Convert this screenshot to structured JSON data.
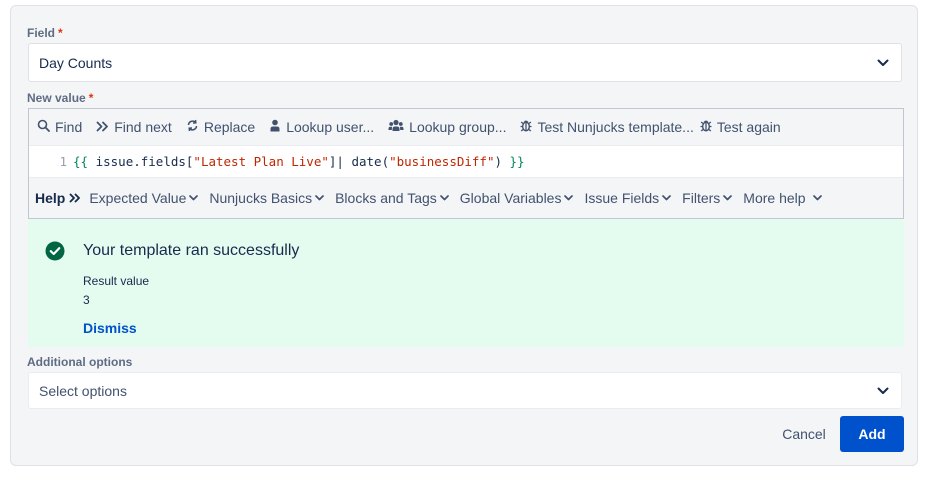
{
  "field": {
    "label": "Field",
    "required_mark": "*",
    "value": "Day Counts"
  },
  "new_value": {
    "label": "New value",
    "required_mark": "*"
  },
  "toolbar": {
    "find": "Find",
    "find_next": "Find next",
    "replace": "Replace",
    "lookup_user": "Lookup user...",
    "lookup_group": "Lookup group...",
    "test_template": "Test Nunjucks template...",
    "test_again": "Test again"
  },
  "editor": {
    "line_number": "1",
    "code": {
      "open": "{{",
      "part1": " issue.fields[",
      "str1": "\"Latest Plan Live\"",
      "part2": "]| date(",
      "str2": "\"businessDiff\"",
      "part3": ") ",
      "close": "}}"
    }
  },
  "help": {
    "title": "Help",
    "items": [
      "Expected Value",
      "Nunjucks Basics",
      "Blocks and Tags",
      "Global Variables",
      "Issue Fields",
      "Filters",
      "More help"
    ]
  },
  "result": {
    "title": "Your template ran successfully",
    "value_label": "Result value",
    "value": "3",
    "dismiss": "Dismiss"
  },
  "additional_options": {
    "label": "Additional options",
    "placeholder": "Select options"
  },
  "buttons": {
    "cancel": "Cancel",
    "add": "Add"
  },
  "colors": {
    "primary": "#0052cc",
    "success_bg": "#e3fcef",
    "success_icon": "#006644",
    "required": "#de350b"
  }
}
